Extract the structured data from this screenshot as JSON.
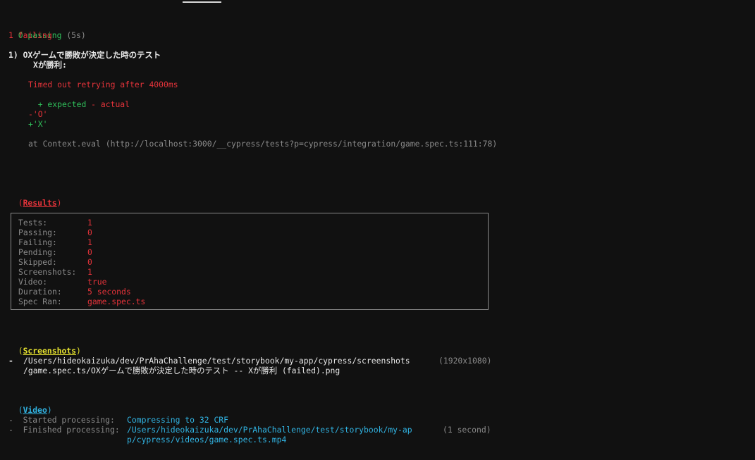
{
  "summary": {
    "passing_count": "0 passing",
    "passing_time": "(5s)",
    "failing": "1 failing"
  },
  "failure": {
    "title": "1) OXゲームで勝敗が決定した時のテスト",
    "subtitle": "Xが勝利:",
    "error": "Timed out retrying after 4000ms",
    "expected": "+ expected",
    "actual": "- actual",
    "diff_minus": "-'O'",
    "diff_plus": "+'X'",
    "stack": "at Context.eval (http://localhost:3000/__cypress/tests?p=cypress/integration/game.spec.ts:111:78)"
  },
  "results": {
    "heading": "Results",
    "rows": [
      {
        "label": "Tests:",
        "value": "1"
      },
      {
        "label": "Passing:",
        "value": "0"
      },
      {
        "label": "Failing:",
        "value": "1"
      },
      {
        "label": "Pending:",
        "value": "0"
      },
      {
        "label": "Skipped:",
        "value": "0"
      },
      {
        "label": "Screenshots:",
        "value": "1"
      },
      {
        "label": "Video:",
        "value": "true"
      },
      {
        "label": "Duration:",
        "value": "5 seconds"
      },
      {
        "label": "Spec Ran:",
        "value": "game.spec.ts"
      }
    ]
  },
  "screenshots": {
    "heading": "Screenshots",
    "bullet": "-",
    "path_line1": "/Users/hideokaizuka/dev/PrAhaChallenge/test/storybook/my-app/cypress/screenshots",
    "path_line2": "/game.spec.ts/OXゲームで勝敗が決定した時のテスト -- Xが勝利 (failed).png",
    "dimensions": "(1920x1080)"
  },
  "video": {
    "heading": "Video",
    "started_label": "-  Started processing:",
    "started_value": "Compressing to 32 CRF",
    "finished_label": "-  Finished processing:",
    "finished_value_line1": "/Users/hideokaizuka/dev/PrAhaChallenge/test/storybook/my-ap",
    "finished_value_line2": "p/cypress/videos/game.spec.ts.mp4",
    "finished_time": "(1 second)"
  }
}
